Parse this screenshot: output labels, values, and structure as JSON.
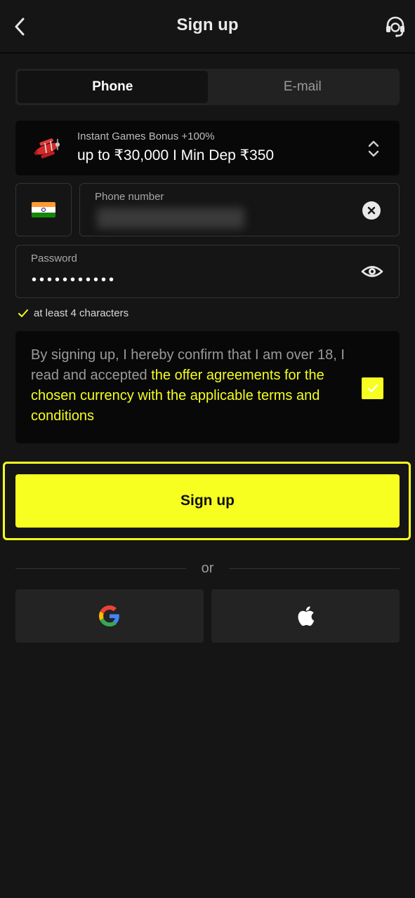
{
  "header": {
    "title": "Sign up",
    "back_icon": "chevron-left-icon",
    "support_icon": "headset-icon"
  },
  "tabs": [
    {
      "label": "Phone",
      "active": true
    },
    {
      "label": "E-mail",
      "active": false
    }
  ],
  "bonus": {
    "subtitle": "Instant Games Bonus +100%",
    "title": "up to ₹30,000 I Min Dep ₹350",
    "icon": "airplane-icon"
  },
  "phone": {
    "label": "Phone number",
    "country_flag": "india-flag-icon"
  },
  "password": {
    "label": "Password",
    "value_masked": "•••••••••••"
  },
  "hint": {
    "text": "at least 4 characters"
  },
  "terms": {
    "text_before": "By signing up, I hereby confirm that I am over 18, I read and accepted ",
    "link_text": "the offer agreements for the chosen currency with the applicable terms and conditions",
    "checked": true
  },
  "actions": {
    "signup_label": "Sign up",
    "or_label": "or",
    "google_icon": "google-icon",
    "apple_icon": "apple-icon"
  },
  "colors": {
    "accent": "#f6ff1f",
    "background": "#151515",
    "card": "#080808"
  }
}
